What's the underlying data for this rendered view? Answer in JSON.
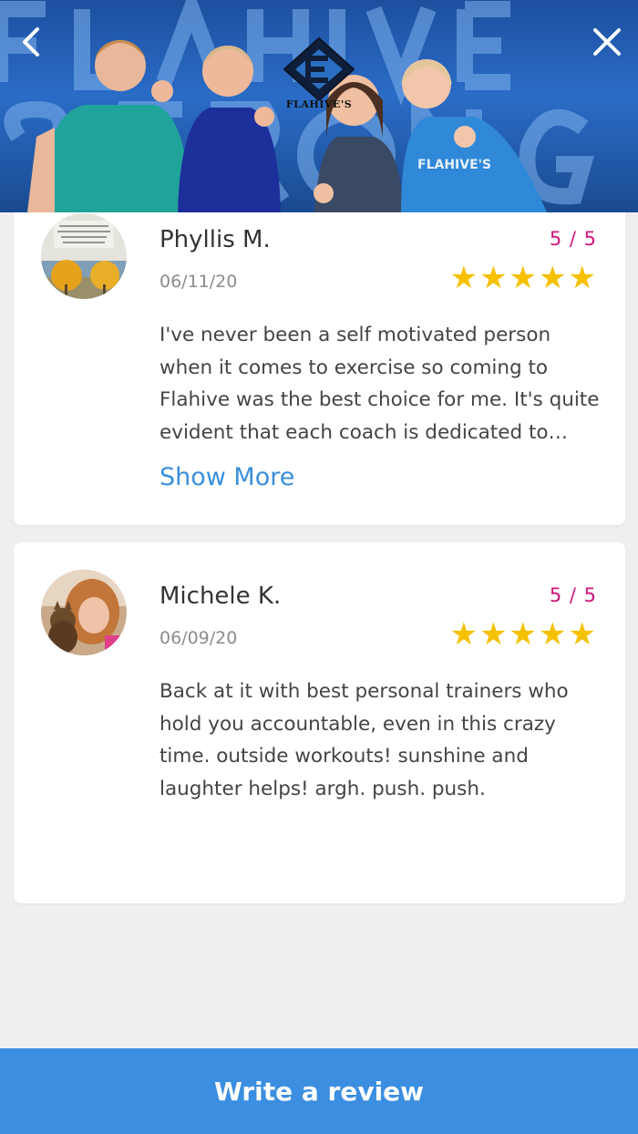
{
  "header": {
    "back_icon": "chevron-left-icon",
    "close_icon": "close-icon",
    "logo_text": "FLAHIVE'S"
  },
  "reviews": [
    {
      "name": "Phyllis M.",
      "score": "5 / 5",
      "date": "06/11/20",
      "stars": "★★★★★",
      "text": "I've never been a self motivated person when it comes to exercise so coming to Flahive was the best choice for me. It's quite evident that each coach is dedicated to helping every member reach their goals.",
      "show_more": "Show More"
    },
    {
      "name": "Michele K.",
      "score": "5 / 5",
      "date": "06/09/20",
      "stars": "★★★★★",
      "text": "Back at it with best personal trainers who hold you accountable, even in this crazy time. outside workouts! sunshine and laughter helps! argh. push. push."
    }
  ],
  "footer": {
    "write_review_label": "Write a review"
  },
  "colors": {
    "accent": "#3b8ee0",
    "score": "#d0167d",
    "star": "#f6c100"
  }
}
